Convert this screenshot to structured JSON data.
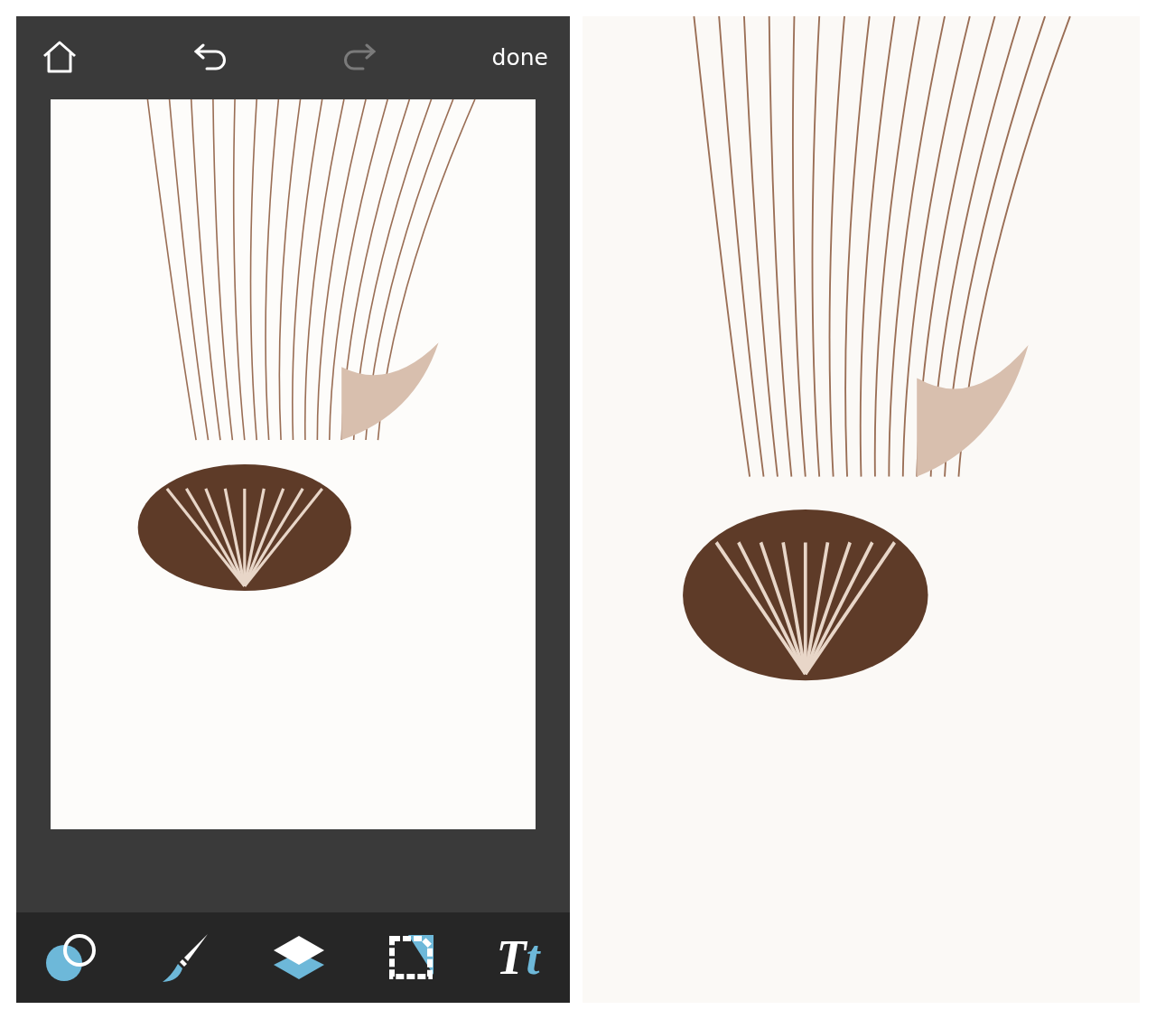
{
  "editor": {
    "top_bar": {
      "actions": [
        {
          "kind": "home",
          "disabled": false
        },
        {
          "kind": "undo",
          "disabled": false
        },
        {
          "kind": "redo",
          "disabled": true
        }
      ],
      "done": "done"
    },
    "tools": [
      {
        "kind": "adjust"
      },
      {
        "kind": "brush"
      },
      {
        "kind": "layers"
      },
      {
        "kind": "frame"
      },
      {
        "kind": "text",
        "glyphs": [
          "T",
          "t"
        ]
      }
    ]
  }
}
